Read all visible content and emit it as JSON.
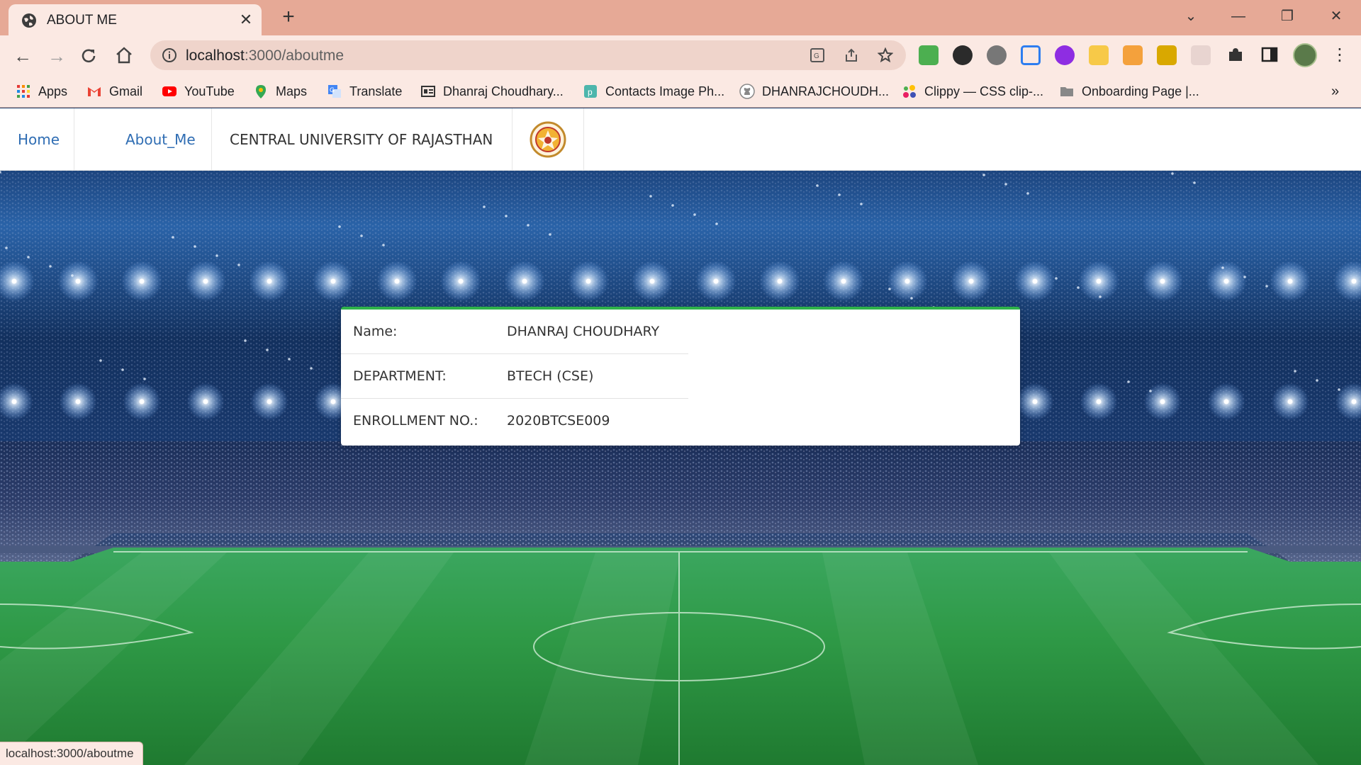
{
  "browser": {
    "tab_title": "ABOUT ME",
    "url_host": "localhost",
    "url_path": ":3000/aboutme",
    "status_url": "localhost:3000/aboutme",
    "bookmarks": [
      {
        "label": "Apps",
        "icon": "apps-grid-icon"
      },
      {
        "label": "Gmail",
        "icon": "gmail-icon"
      },
      {
        "label": "YouTube",
        "icon": "youtube-icon"
      },
      {
        "label": "Maps",
        "icon": "maps-pin-icon"
      },
      {
        "label": "Translate",
        "icon": "translate-icon"
      },
      {
        "label": "Dhanraj Choudhary...",
        "icon": "id-card-icon"
      },
      {
        "label": "Contacts Image Ph...",
        "icon": "contacts-icon"
      },
      {
        "label": "DHANRAJCHOUDH...",
        "icon": "github-icon"
      },
      {
        "label": "Clippy — CSS clip-...",
        "icon": "clippy-icon"
      },
      {
        "label": "Onboarding Page |...",
        "icon": "folder-icon"
      }
    ],
    "more_bookmarks": "»"
  },
  "navbar": {
    "home": "Home",
    "about": "About_Me",
    "university": "CENTRAL UNIVERSITY OF RAJASTHAN"
  },
  "profile": {
    "rows": [
      {
        "label": "Name:",
        "value": "DHANRAJ CHOUDHARY"
      },
      {
        "label": "DEPARTMENT:",
        "value": "BTECH (CSE)"
      },
      {
        "label": "ENROLLMENT NO.:",
        "value": "2020BTCSE009"
      }
    ]
  },
  "colors": {
    "accent_green": "#2fb34a",
    "link_blue": "#2f6db3",
    "chrome_tab_bar": "#e6a996"
  }
}
